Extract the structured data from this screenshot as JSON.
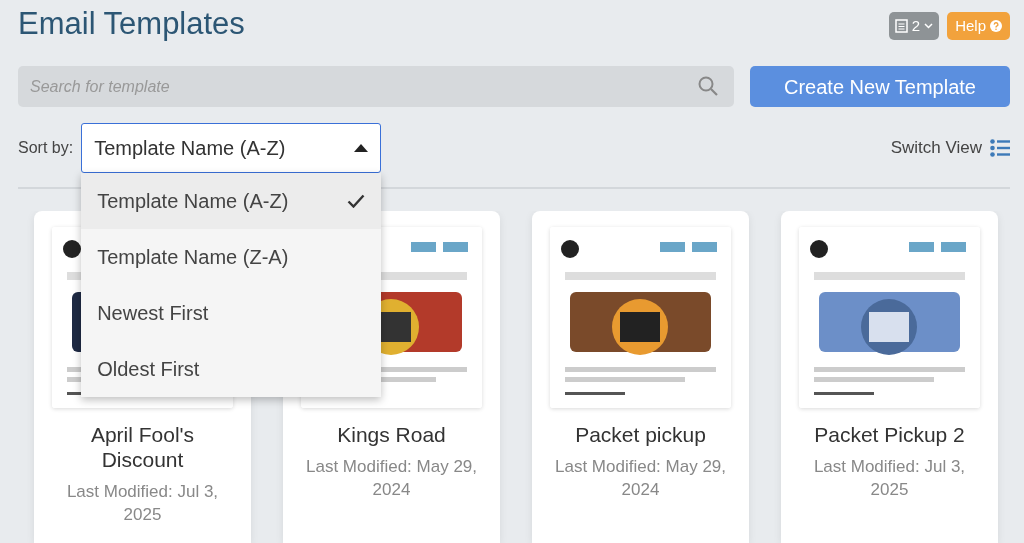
{
  "title": "Email Templates",
  "header_buttons": {
    "count": "2",
    "help": "Help"
  },
  "search": {
    "placeholder": "Search for template"
  },
  "create_button": "Create New Template",
  "sort": {
    "label": "Sort by:",
    "value": "Template Name (A-Z)",
    "expanded": true,
    "options": [
      {
        "label": "Template Name (A-Z)",
        "selected": true
      },
      {
        "label": "Template Name (Z-A)",
        "selected": false
      },
      {
        "label": "Newest First",
        "selected": false
      },
      {
        "label": "Oldest First",
        "selected": false
      }
    ]
  },
  "switch_view": "Switch View",
  "templates": [
    {
      "name": "April Fool's Discount",
      "modified": "Last Modified: Jul 3, 2025"
    },
    {
      "name": "Kings Road",
      "modified": "Last Modified: May 29, 2024"
    },
    {
      "name": "Packet pickup",
      "modified": "Last Modified: May 29, 2024"
    },
    {
      "name": "Packet Pickup 2",
      "modified": "Last Modified: Jul 3, 2025"
    }
  ]
}
